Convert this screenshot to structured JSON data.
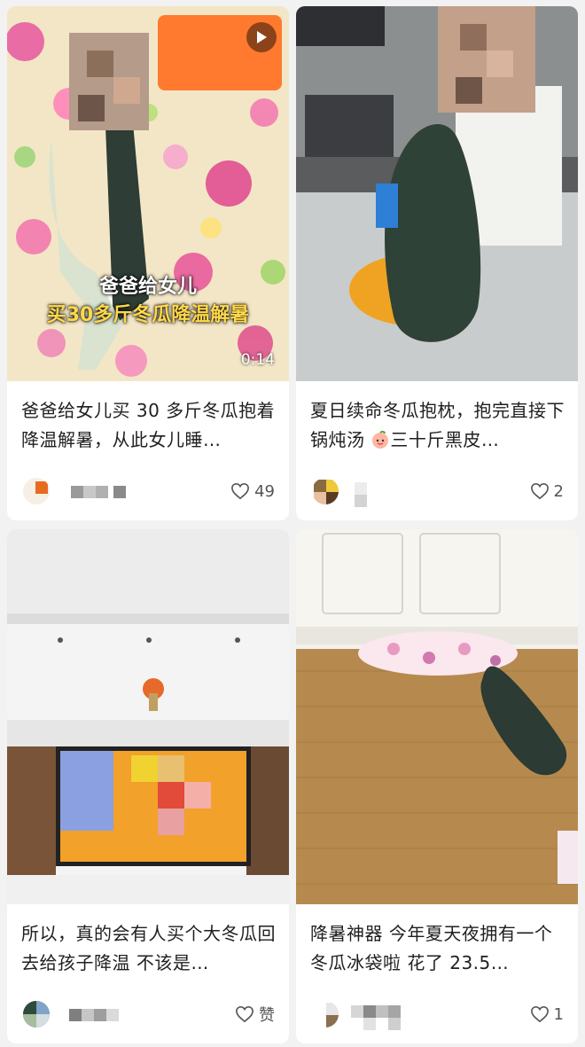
{
  "feed": {
    "cards": [
      {
        "title": "爸爸给女儿买 30 多斤冬瓜抱着降温解暑，从此女儿睡…",
        "likes": "49",
        "video": {
          "line1": "爸爸给女儿",
          "line2": "买30多斤冬瓜降温解暑",
          "duration": "0:14"
        }
      },
      {
        "title_before": "夏日续命冬瓜抱枕，抱完直接下锅炖汤 ",
        "title_after": "三十斤黑皮…",
        "emoji": "peach-face-icon",
        "likes": "2"
      },
      {
        "title": "所以，真的会有人买个大冬瓜回去给孩子降温 不该是…",
        "likes": "赞"
      },
      {
        "title": "降暑神器 今年夏天夜拥有一个冬瓜冰袋啦 花了 23.5…",
        "likes": "1"
      }
    ]
  },
  "colors": {
    "background": "#f2f2f2",
    "card": "#ffffff",
    "text": "#1f1f1f",
    "overlay_yellow": "#ffd84a"
  },
  "icons": [
    "play-icon",
    "heart-outline-icon",
    "peach-face-icon"
  ]
}
